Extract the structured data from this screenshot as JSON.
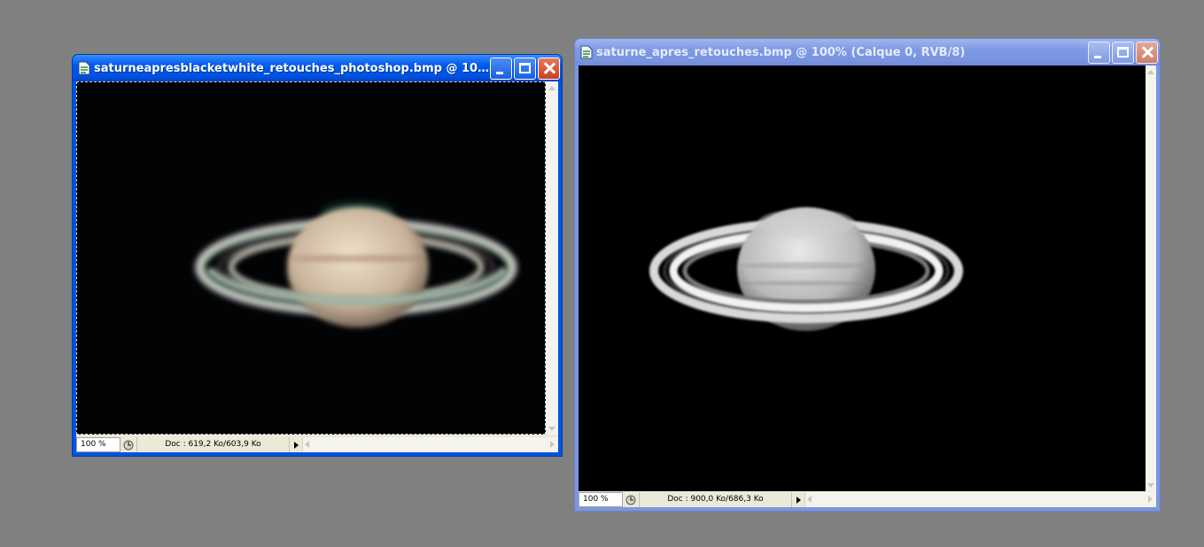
{
  "windows": [
    {
      "title": "saturneapresblacketwhite_retouches_photoshop.bmp @ 100% (...",
      "zoom": "100 %",
      "doc_info": "Doc : 619,2 Ko/603,9 Ko",
      "image": "color-saturn-blurry",
      "state": "active"
    },
    {
      "title": "saturne_apres_retouches.bmp @ 100% (Calque 0, RVB/8)",
      "zoom": "100 %",
      "doc_info": "Doc : 900,0 Ko/686,3 Ko",
      "image": "grayscale-saturn-sharpened",
      "state": "inactive"
    }
  ],
  "colors": {
    "desktop": "#808080",
    "active_title": "#0054e3",
    "inactive_title": "#7b97e0",
    "canvas": "#000000"
  }
}
